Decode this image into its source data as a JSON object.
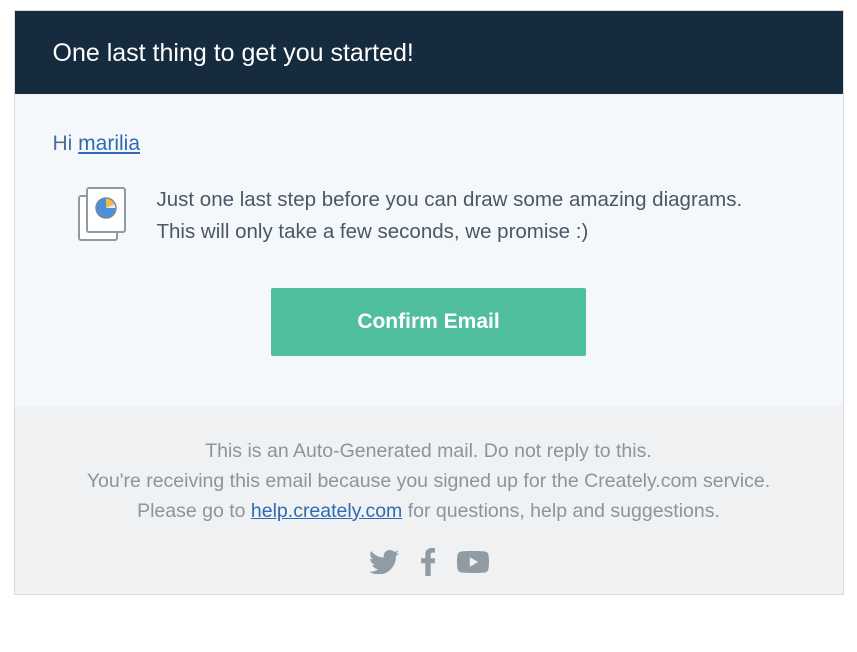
{
  "header": {
    "title": "One last thing to get you started!"
  },
  "greeting": {
    "prefix": "Hi ",
    "name": "marilia"
  },
  "message": {
    "line1": "Just one last step before you can draw some amazing diagrams.",
    "line2": "This will only take a few seconds, we promise :)"
  },
  "cta": {
    "label": "Confirm Email"
  },
  "footer": {
    "line1": "This is an Auto-Generated mail. Do not reply to this.",
    "line2": "You're receiving this email because you signed up for the Creately.com service.",
    "line3_prefix": "Please go to ",
    "help_link_text": "help.creately.com",
    "line3_suffix": " for questions, help and suggestions."
  }
}
